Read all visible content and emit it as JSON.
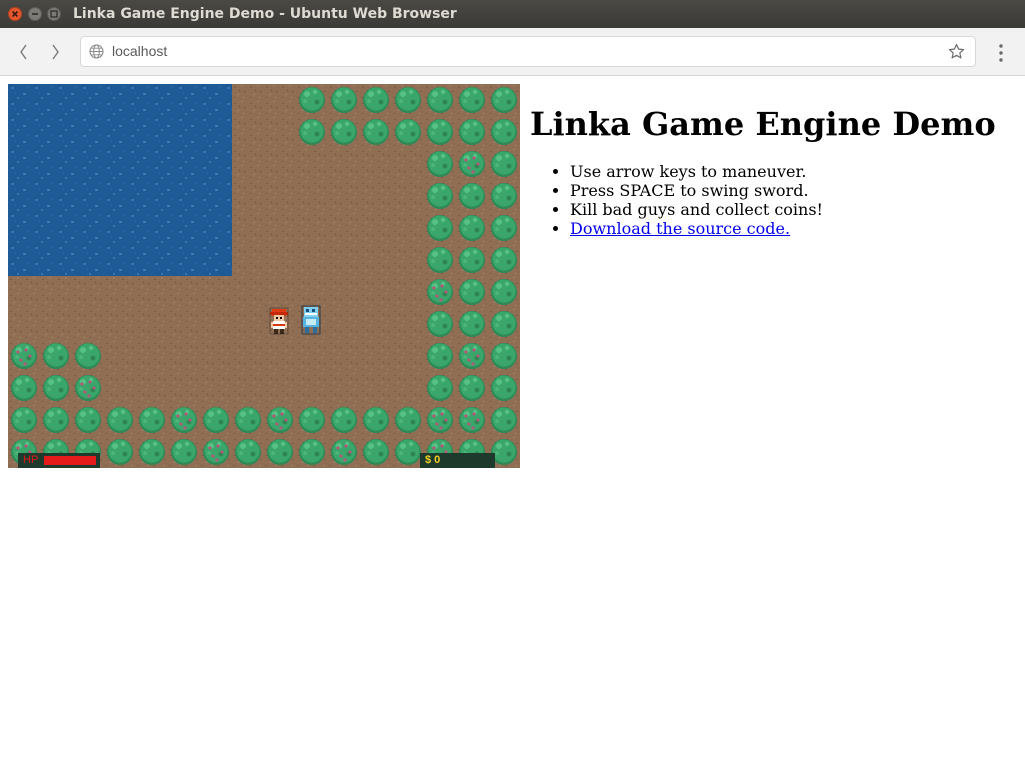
{
  "window": {
    "title": "Linka Game Engine Demo - Ubuntu Web Browser"
  },
  "browser": {
    "url": "localhost"
  },
  "game": {
    "hud": {
      "hp_label": "HP",
      "hp_fraction": 1.0,
      "money_label": "$ 0"
    },
    "colors": {
      "water": "#1d5a96",
      "dirt": "#8f6e54",
      "tree": "#3aa66a",
      "hp_bar": "#e51a1a",
      "money_text": "#f2d125"
    }
  },
  "page": {
    "heading": "Linka Game Engine Demo",
    "instructions": [
      "Use arrow keys to maneuver.",
      "Press SPACE to swing sword.",
      "Kill bad guys and collect coins!"
    ],
    "download_link": "Download the source code."
  }
}
